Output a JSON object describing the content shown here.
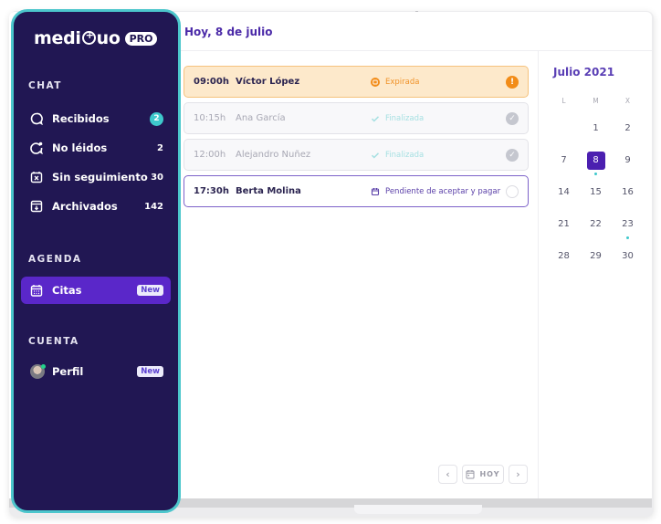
{
  "app": {
    "logo_text": "medi",
    "logo_text_after": "uo",
    "logo_badge": "PRO",
    "header_title": "Hoy, 8 de julio"
  },
  "sidebar": {
    "chat_title": "CHAT",
    "chat_items": [
      {
        "label": "Recibidos",
        "count": "2",
        "icon": "chat-bubble-icon",
        "count_style": "badge"
      },
      {
        "label": "No léidos",
        "count": "2",
        "icon": "chat-unread-icon",
        "count_style": "plain"
      },
      {
        "label": "Sin seguimiento",
        "count": "30",
        "icon": "calendar-x-icon",
        "count_style": "plain"
      },
      {
        "label": "Archivados",
        "count": "142",
        "icon": "archive-icon",
        "count_style": "plain"
      }
    ],
    "agenda_title": "AGENDA",
    "agenda_items": [
      {
        "label": "Citas",
        "badge": "New",
        "icon": "calendar-icon",
        "active": true
      }
    ],
    "account_title": "CUENTA",
    "account_items": [
      {
        "label": "Perfil",
        "badge": "New",
        "icon": "avatar"
      }
    ]
  },
  "appointments": [
    {
      "time": "09:00h",
      "name": "Víctor López",
      "status": "Expirada",
      "state": "expired",
      "status_icon": "calendar-expired-icon",
      "end_icon": "alert-icon",
      "end_glyph": "!"
    },
    {
      "time": "10:15h",
      "name": "Ana García",
      "status": "Finalizada",
      "state": "done",
      "status_icon": "check-icon",
      "end_icon": "check-circle-icon",
      "end_glyph": "✓"
    },
    {
      "time": "12:00h",
      "name": "Alejandro Nuñez",
      "status": "Finalizada",
      "state": "done",
      "status_icon": "check-icon",
      "end_icon": "check-circle-icon",
      "end_glyph": "✓"
    },
    {
      "time": "17:30h",
      "name": "Berta Molina",
      "status": "Pendiente de aceptar y pagar",
      "state": "pending",
      "status_icon": "calendar-icon",
      "end_icon": "empty-circle-icon",
      "end_glyph": ""
    }
  ],
  "calendar": {
    "title": "Julio 2021",
    "weekdays": [
      "L",
      "M",
      "X"
    ],
    "weeks": [
      [
        "",
        "1",
        "2"
      ],
      [
        "7",
        "8",
        "9"
      ],
      [
        "14",
        "15",
        "16"
      ],
      [
        "21",
        "22",
        "23"
      ],
      [
        "28",
        "29",
        "30"
      ]
    ],
    "selected_day": "8",
    "event_days": [
      "8",
      "23"
    ]
  },
  "nav": {
    "prev_glyph": "‹",
    "today_label": "HOY",
    "next_glyph": "›"
  },
  "colors": {
    "sidebar_bg": "#211753",
    "sidebar_border": "#4cc6cc",
    "accent_purple": "#5a27c9",
    "expired_orange": "#f28c18",
    "teal": "#3ec8cc"
  }
}
